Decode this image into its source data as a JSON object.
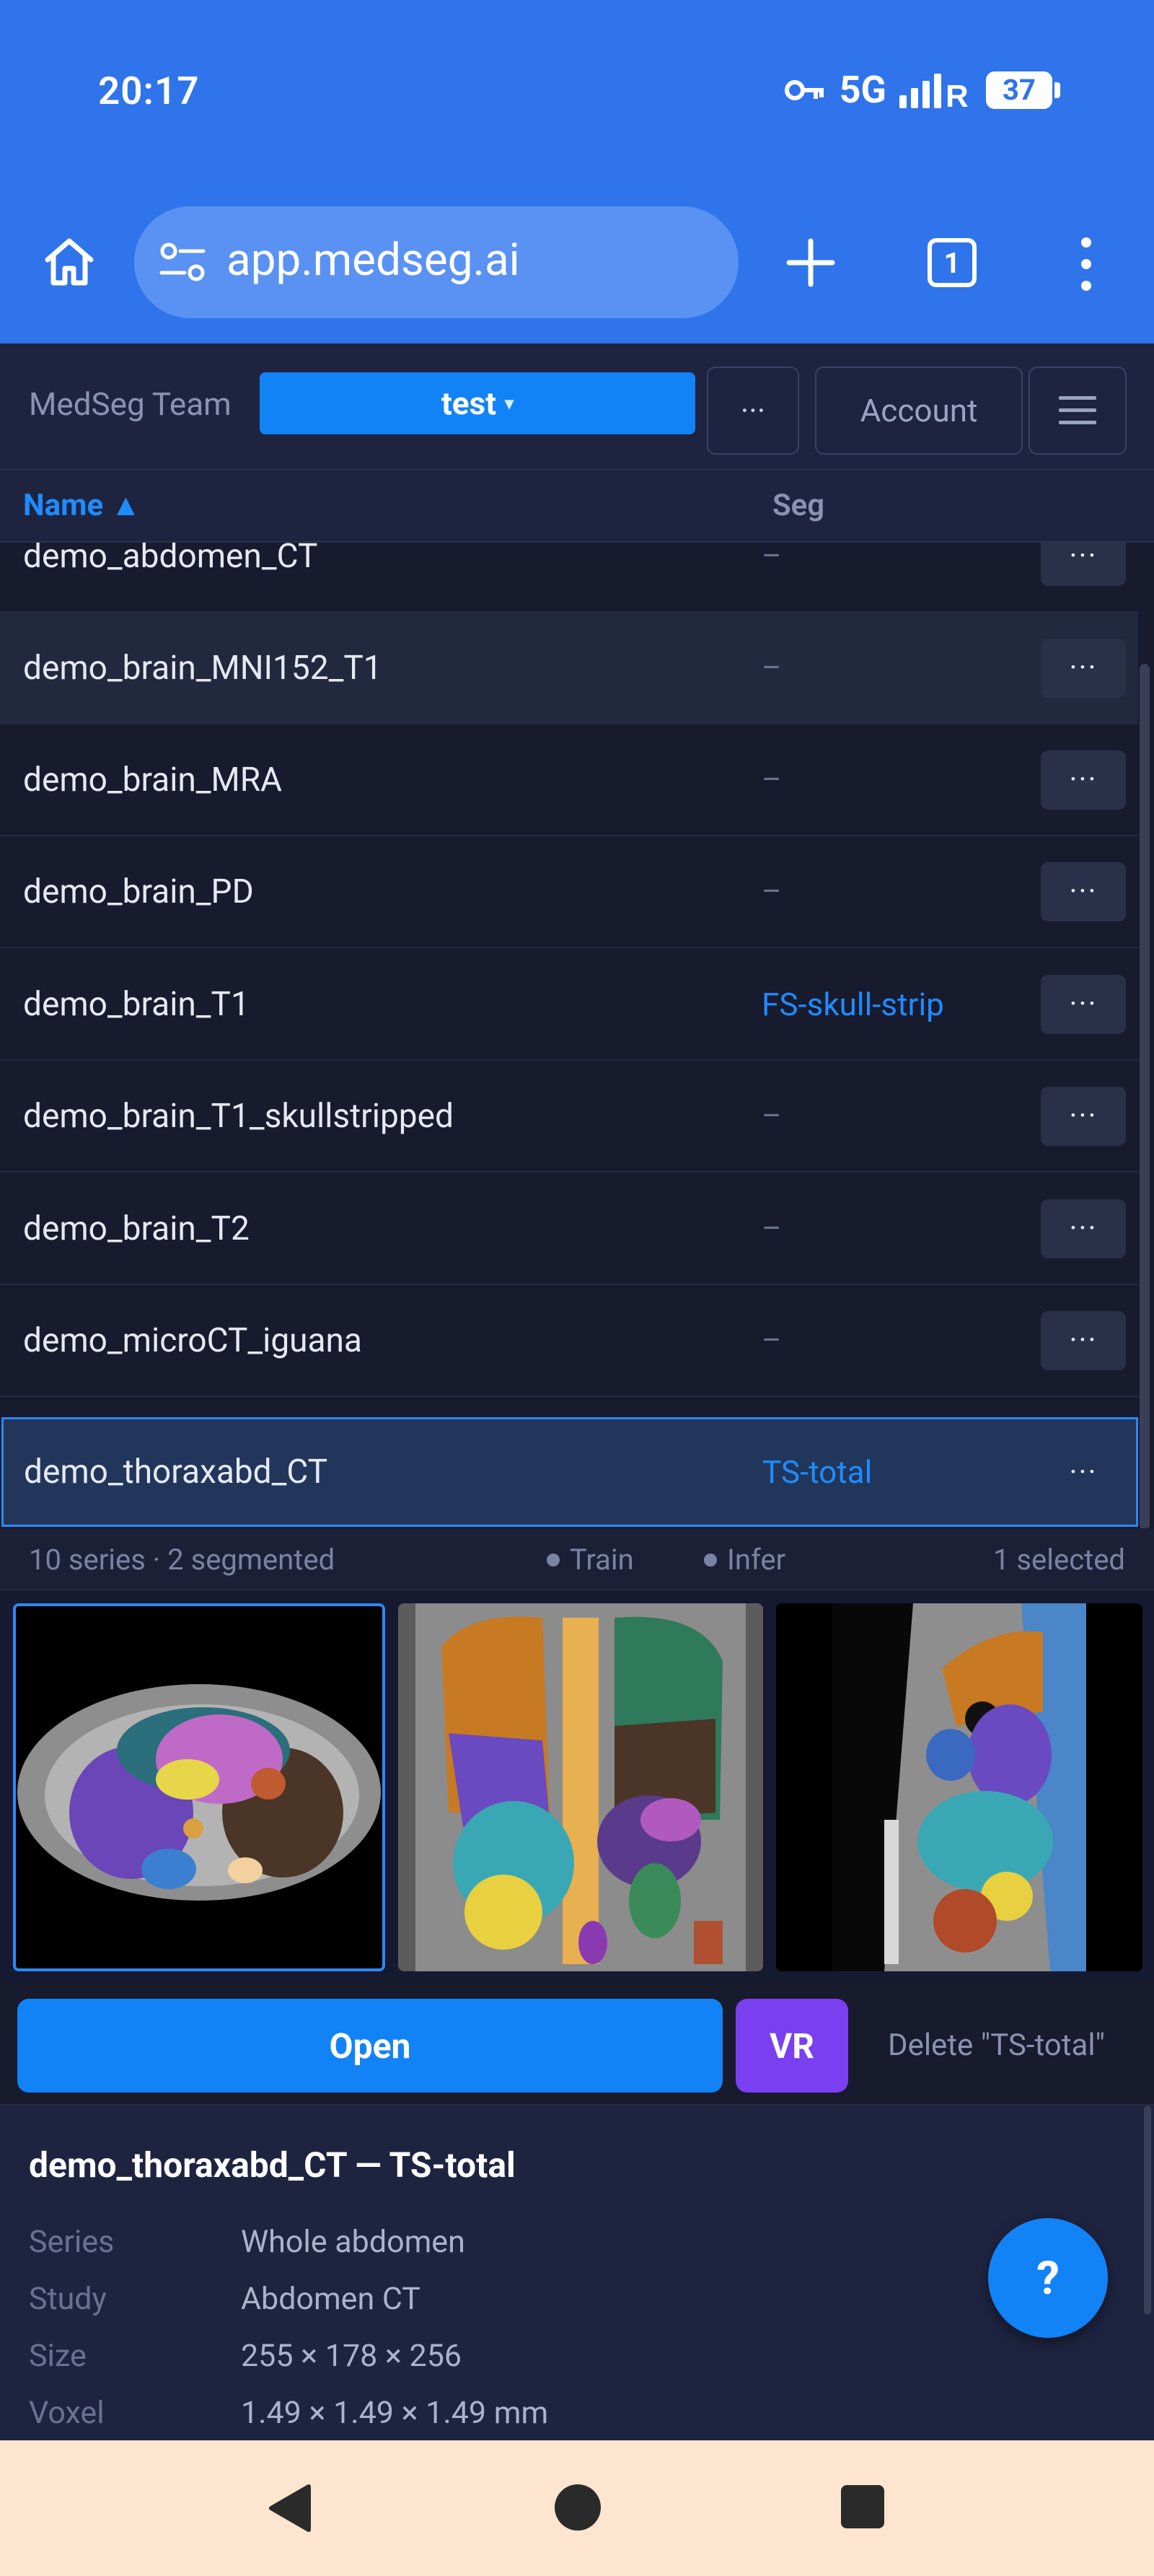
{
  "status_bar": {
    "time": "20:17",
    "network": "5G",
    "battery": "37"
  },
  "browser": {
    "url": "app.medseg.ai",
    "tab_count": "1"
  },
  "toolbar": {
    "team": "MedSeg Team",
    "project": "test",
    "project_caret": "▾",
    "more": "···",
    "account": "Account"
  },
  "table": {
    "header_name": "Name ▲",
    "header_seg": "Seg",
    "more_label": "···",
    "rows": [
      {
        "name": "demo_abdomen_CT",
        "seg": "–"
      },
      {
        "name": "demo_brain_MNI152_T1",
        "seg": "–"
      },
      {
        "name": "demo_brain_MRA",
        "seg": "–"
      },
      {
        "name": "demo_brain_PD",
        "seg": "–"
      },
      {
        "name": "demo_brain_T1",
        "seg": "FS-skull-strip"
      },
      {
        "name": "demo_brain_T1_skullstripped",
        "seg": "–"
      },
      {
        "name": "demo_brain_T2",
        "seg": "–"
      },
      {
        "name": "demo_microCT_iguana",
        "seg": "–"
      },
      {
        "name": "demo_thoraxabd_CT",
        "seg": "TS-total"
      }
    ]
  },
  "stats": {
    "summary": "10 series · 2 segmented",
    "train": "Train",
    "infer": "Infer",
    "selected": "1 selected"
  },
  "actions": {
    "open": "Open",
    "vr": "VR",
    "delete": "Delete \"TS-total\""
  },
  "info": {
    "title": "demo_thoraxabd_CT — TS-total",
    "rows": [
      {
        "key": "Series",
        "value": "Whole abdomen"
      },
      {
        "key": "Study",
        "value": "Abdomen CT"
      },
      {
        "key": "Size",
        "value": "255 × 178 × 256"
      },
      {
        "key": "Voxel",
        "value": "1.49 × 1.49 × 1.49 mm"
      }
    ]
  },
  "help_label": "?",
  "colors": {
    "chrome": "#2f74eb",
    "accent": "#1283f7",
    "vr": "#7a3ff0",
    "link": "#1e8cff",
    "navbar": "#fde5cf"
  }
}
